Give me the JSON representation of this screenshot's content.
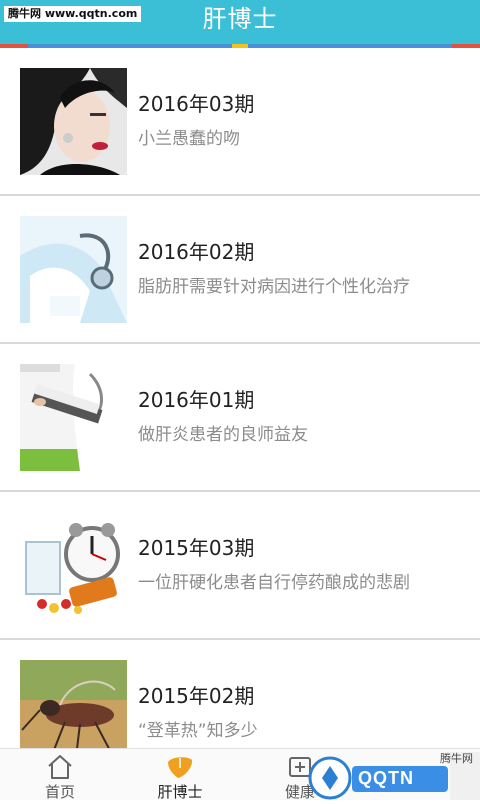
{
  "header": {
    "title": "肝博士",
    "watermark": "腾牛网 www.qqtn.com",
    "colors": {
      "bg": "#3bbfd6",
      "strip_left": "#e0533c",
      "strip_mid": "#f0c419",
      "strip_right": "#e0533c",
      "strip_base": "#4a90d9"
    }
  },
  "issues": [
    {
      "title": "2016年03期",
      "subtitle": "小兰愚蠢的吻",
      "thumb": "woman-portrait-image"
    },
    {
      "title": "2016年02期",
      "subtitle": "脂肪肝需要针对病因进行个性化治疗",
      "thumb": "doctor-stethoscope-image"
    },
    {
      "title": "2016年01期",
      "subtitle": "做肝炎患者的良师益友",
      "thumb": "doctor-clipboard-image"
    },
    {
      "title": "2015年03期",
      "subtitle": "一位肝硬化患者自行停药酿成的悲剧",
      "thumb": "clock-pills-image"
    },
    {
      "title": "2015年02期",
      "subtitle": "“登革热”知多少",
      "thumb": "mosquito-image"
    }
  ],
  "tabs": [
    {
      "label": "首页",
      "icon": "home-icon"
    },
    {
      "label": "肝博士",
      "icon": "liver-icon",
      "active": true
    },
    {
      "label": "健康",
      "icon": "health-icon"
    }
  ],
  "badge": {
    "text": "QQTN",
    "corner_text": "腾牛网"
  }
}
